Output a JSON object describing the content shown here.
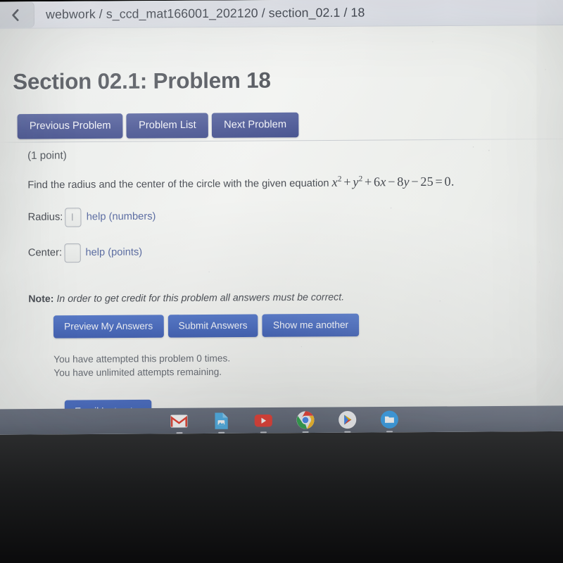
{
  "browser": {
    "back_icon": "chevron-left-icon",
    "breadcrumb": "webwork / s_ccd_mat166001_202120 / section_02.1 / 18"
  },
  "page": {
    "title": "Section 02.1: Problem 18",
    "nav_buttons": [
      {
        "label": "Previous Problem",
        "name": "previous-problem-button"
      },
      {
        "label": "Problem List",
        "name": "problem-list-button"
      },
      {
        "label": "Next Problem",
        "name": "next-problem-button"
      }
    ],
    "points": "(1 point)",
    "prompt_prefix": "Find the radius and the center of the circle with the given equation",
    "equation": {
      "full": "x² + y² + 6x − 8y − 25 = 0.",
      "terms": {
        "x_sq_base": "x",
        "x_sq_exp": "2",
        "plus_1": "+",
        "y_sq_base": "y",
        "y_sq_exp": "2",
        "plus_2": "+",
        "coef_6": "6",
        "var_x": "x",
        "minus_1": "−",
        "coef_8": "8",
        "var_y": "y",
        "minus_2": "−",
        "const_25": "25",
        "equals": "=",
        "rhs": "0",
        "period": "."
      }
    },
    "answers": [
      {
        "label": "Radius:",
        "value": "",
        "placeholder": "",
        "help_label": "help (numbers)",
        "field_name": "radius-input",
        "help_name": "help-numbers-link",
        "focused": true
      },
      {
        "label": "Center:",
        "value": "",
        "placeholder": "",
        "help_label": "help (points)",
        "field_name": "center-input",
        "help_name": "help-points-link",
        "focused": false
      }
    ],
    "note_label": "Note:",
    "note_text": " In order to get credit for this problem all answers must be correct.",
    "action_buttons": [
      {
        "label": "Preview My Answers",
        "name": "preview-my-answers-button"
      },
      {
        "label": "Submit Answers",
        "name": "submit-answers-button"
      },
      {
        "label": "Show me another",
        "name": "show-me-another-button"
      }
    ],
    "attempts_line_1": "You have attempted this problem 0 times.",
    "attempts_line_2": "You have unlimited attempts remaining.",
    "email_instructor_label": "Email Instructor"
  },
  "shelf": {
    "icons": [
      {
        "name": "gmail-icon",
        "label": "Gmail"
      },
      {
        "name": "google-docs-icon",
        "label": "Docs"
      },
      {
        "name": "youtube-icon",
        "label": "YouTube"
      },
      {
        "name": "chrome-icon",
        "label": "Chrome"
      },
      {
        "name": "google-play-icon",
        "label": "Play Store"
      },
      {
        "name": "files-icon",
        "label": "Files"
      }
    ]
  },
  "colors": {
    "nav_button": "#4a5694",
    "action_button": "#4e6fc0",
    "link": "#5d6ea3",
    "page_background": "#eceeec",
    "shelf": "#676e7d",
    "title_text": "#4a4e55"
  }
}
